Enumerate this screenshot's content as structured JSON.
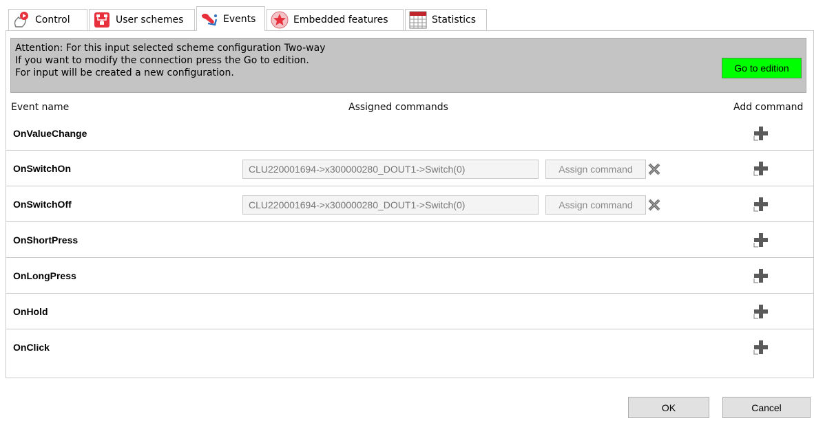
{
  "tabs": [
    {
      "label": "Control",
      "icon": "hand-pointer-icon"
    },
    {
      "label": "User schemes",
      "icon": "user-schemes-icon"
    },
    {
      "label": "Events",
      "icon": "events-icon"
    },
    {
      "label": "Embedded features",
      "icon": "star-icon"
    },
    {
      "label": "Statistics",
      "icon": "calendar-grid-icon"
    }
  ],
  "active_tab": "Events",
  "alert": {
    "line1": "Attention: For this input selected scheme configuration Two-way",
    "line2": "If you want to modify the connection press the Go to edition.",
    "line3": "For input will be created a new configuration.",
    "go_to_edition": "Go to edition"
  },
  "columns": {
    "event_name": "Event name",
    "assigned_commands": "Assigned commands",
    "add_command": "Add command"
  },
  "events": [
    {
      "name": "OnValueChange"
    },
    {
      "name": "OnSwitchOn",
      "command": "CLU220001694->x300000280_DOUT1->Switch(0)",
      "assign_label": "Assign command"
    },
    {
      "name": "OnSwitchOff",
      "command": "CLU220001694->x300000280_DOUT1->Switch(0)",
      "assign_label": "Assign command"
    },
    {
      "name": "OnShortPress"
    },
    {
      "name": "OnLongPress"
    },
    {
      "name": "OnHold"
    },
    {
      "name": "OnClick"
    }
  ],
  "buttons": {
    "ok": "OK",
    "cancel": "Cancel"
  },
  "colors": {
    "go_button": "#00ff00",
    "alert_bg": "#c4c4c4",
    "accent_red": "#e8303c"
  }
}
